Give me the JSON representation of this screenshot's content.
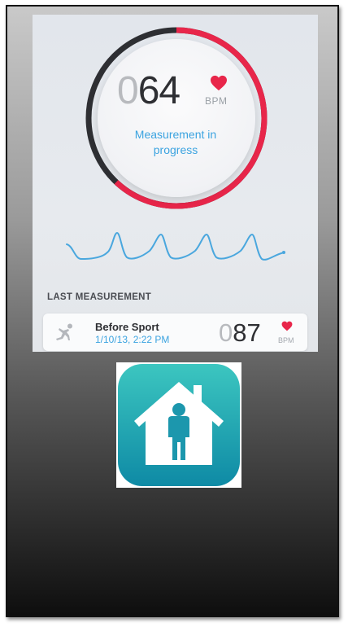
{
  "screen": {
    "bpm": {
      "leading_zero": "0",
      "digits": "64",
      "unit": "BPM"
    },
    "status_text": "Measurement in progress",
    "last_measurement": {
      "heading": "LAST MEASUREMENT",
      "title": "Before Sport",
      "datetime": "1/10/13, 2:22 PM",
      "leading_zero": "0",
      "digits": "87",
      "unit": "BPM"
    },
    "progress_fraction": 0.62
  },
  "icons": {
    "heart": "heart-icon",
    "runner": "runner-icon",
    "app": "home-person-app-icon"
  },
  "colors": {
    "accent_red": "#e8264a",
    "accent_blue": "#3ba3e0",
    "ring_dark": "#2e2f33",
    "app_teal": "#1fa3b0"
  }
}
